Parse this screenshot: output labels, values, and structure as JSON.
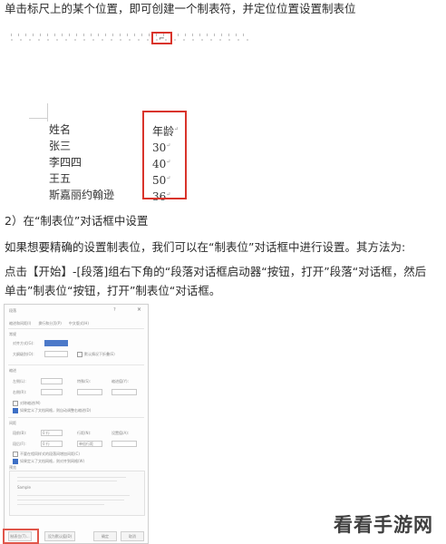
{
  "doc": {
    "intro_line": "单击标尺上的某个位置，即可创建一个制表符，并定位位置设置制表位",
    "ruler": {
      "tab_stop_glyph": "⌐"
    },
    "table": {
      "names": [
        "姓名",
        "张三",
        "李四四",
        "王五",
        "斯嘉丽约翰逊"
      ],
      "ages": [
        "年龄",
        "30",
        "40",
        "50",
        "36"
      ],
      "paragraph_mark": "↵"
    },
    "section2_heading": "2）在“制表位”对话框中设置",
    "para_line1": "如果想要精确的设置制表位，我们可以在“制表位”对话框中进行设置。其方法为:",
    "para_line2": "点击【开始】-[段落]组右下角的“段落对话框启动器“按钮，打开”段落“对话框，然后",
    "para_line3": "单击”制表位“按钮，打开”制表位“对话框。"
  },
  "dialog": {
    "title": "段落",
    "help": "?",
    "close": "×",
    "tabs": [
      "缩进和间距(I)",
      "换行和分页(P)",
      "中文版式(H)"
    ],
    "section_general": "常规",
    "alignment_label": "对齐方式(G):",
    "alignment_value": "两端对齐",
    "outline_label": "大纲级别(O):",
    "outline_value": "正文文本",
    "collapsed_label": "默认情况下折叠(E)",
    "section_indent": "缩进",
    "left_label": "左侧(L):",
    "right_label": "右侧(R):",
    "special_label": "特殊(S):",
    "indent_by_label": "缩进值(Y):",
    "mirror_label": "对称缩进(M)",
    "grid_indent_label": "如果定义了文档网格，则自动调整右缩进(D)",
    "section_spacing": "间距",
    "before_label": "段前(B):",
    "before_value": "0 行",
    "after_label": "段后(F):",
    "after_value": "0 行",
    "line_spacing_label": "行距(N):",
    "line_spacing_value": "单倍行距",
    "set_value_label": "设置值(A):",
    "no_space_label": "不要在相同样式的段落间增加间距(C)",
    "snap_grid_label": "如果定义了文档网格，则对齐到网格(W)",
    "section_preview": "预览",
    "preview_sample": "Sample",
    "btn_tabs": "制表位(T)...",
    "btn_default": "设为默认值(D)",
    "btn_ok": "确定",
    "btn_cancel": "取消"
  },
  "watermark": "看看手游网",
  "colors": {
    "highlight_red": "#d9342b",
    "dialog_blue": "#4c79c9"
  }
}
